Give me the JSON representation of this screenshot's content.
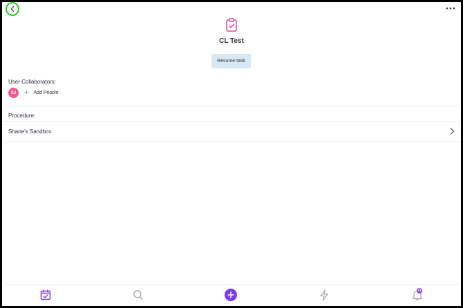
{
  "header": {
    "back_icon": "chevron-left-icon",
    "more_icon": "ellipsis-icon"
  },
  "task": {
    "icon": "clipboard-check-icon",
    "title": "CL Test",
    "resume_label": "Resume task"
  },
  "collaborators": {
    "label": "User Collaborators:",
    "users": [
      {
        "initials": "SJ",
        "color": "#f0568f"
      }
    ],
    "add_label": "Add People"
  },
  "procedure": {
    "label": "Procedure:",
    "name": "Shane's Sandbox"
  },
  "tabbar": {
    "tabs": [
      {
        "name": "tasks",
        "icon": "calendar-check-icon",
        "active": true
      },
      {
        "name": "search",
        "icon": "search-icon"
      },
      {
        "name": "add",
        "icon": "plus-icon"
      },
      {
        "name": "activity",
        "icon": "lightning-icon"
      },
      {
        "name": "notifications",
        "icon": "bell-icon",
        "badge": "21"
      }
    ]
  },
  "colors": {
    "accent": "#7b3aed",
    "pink": "#e0479e",
    "highlight": "#22d11b",
    "button_bg": "#d9e8f5",
    "text": "#2c3141"
  }
}
